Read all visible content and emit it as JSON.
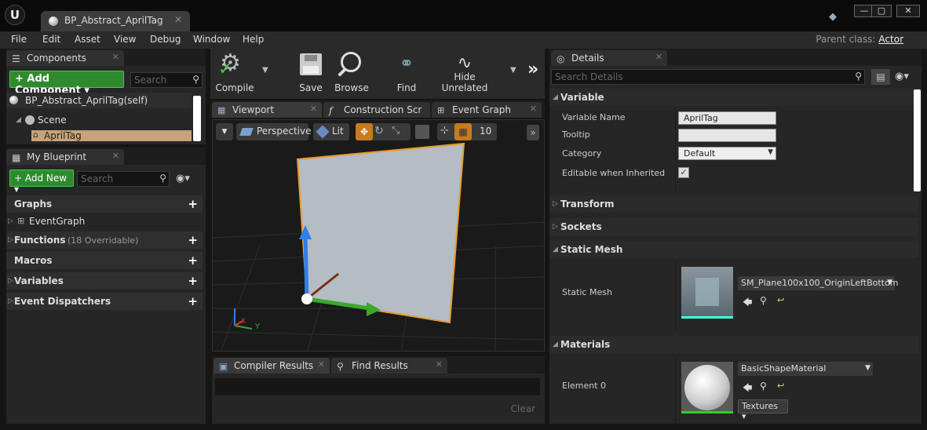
{
  "window": {
    "doc_tab": "BP_Abstract_AprilTag",
    "logo": "U",
    "parent_class_label": "Parent class:",
    "parent_class_value": "Actor"
  },
  "menu": [
    "File",
    "Edit",
    "Asset",
    "View",
    "Debug",
    "Window",
    "Help"
  ],
  "components": {
    "tab": "Components",
    "add_button": "+ Add Component ▾",
    "search_placeholder": "Search",
    "items": [
      "BP_Abstract_AprilTag(self)",
      "Scene",
      "AprilTag"
    ]
  },
  "my_blueprint": {
    "tab": "My Blueprint",
    "add_new": "+ Add New ▾",
    "search_placeholder": "Search",
    "sections": [
      {
        "label": "Graphs",
        "note": ""
      },
      {
        "label": "EventGraph",
        "note": ""
      },
      {
        "label": "Functions",
        "note": "(18 Overridable)"
      },
      {
        "label": "Macros",
        "note": ""
      },
      {
        "label": "Variables",
        "note": ""
      },
      {
        "label": "Event Dispatchers",
        "note": ""
      }
    ]
  },
  "toolbar": {
    "compile": "Compile",
    "save": "Save",
    "browse": "Browse",
    "find": "Find",
    "hide_unrelated": "Hide Unrelated"
  },
  "editor_tabs": [
    "Viewport",
    "Construction Scr",
    "Event Graph"
  ],
  "viewport": {
    "perspective": "Perspective",
    "lit": "Lit",
    "grid_snap": "10",
    "axis_x": "X",
    "axis_y": "Y"
  },
  "bottom": {
    "tabs": [
      "Compiler Results",
      "Find Results"
    ],
    "clear": "Clear"
  },
  "details": {
    "tab": "Details",
    "search_placeholder": "Search Details",
    "variable_section": "Variable",
    "variable_name_label": "Variable Name",
    "variable_name_value": "AprilTag",
    "tooltip_label": "Tooltip",
    "tooltip_value": "",
    "category_label": "Category",
    "category_value": "Default",
    "editable_label": "Editable when Inherited",
    "editable_checked": true,
    "transform_section": "Transform",
    "sockets_section": "Sockets",
    "static_mesh_section": "Static Mesh",
    "static_mesh_label": "Static Mesh",
    "static_mesh_value": "SM_Plane100x100_OriginLeftBottom",
    "materials_section": "Materials",
    "element0_label": "Element 0",
    "element0_value": "BasicShapeMaterial",
    "textures_button": "Textures ▾"
  },
  "colors": {
    "accent_green": "#2f8a2f",
    "selection_tan": "#c8a27a",
    "mesh_plane": "#b4bcc4",
    "plane_outline": "#e89b2a"
  }
}
